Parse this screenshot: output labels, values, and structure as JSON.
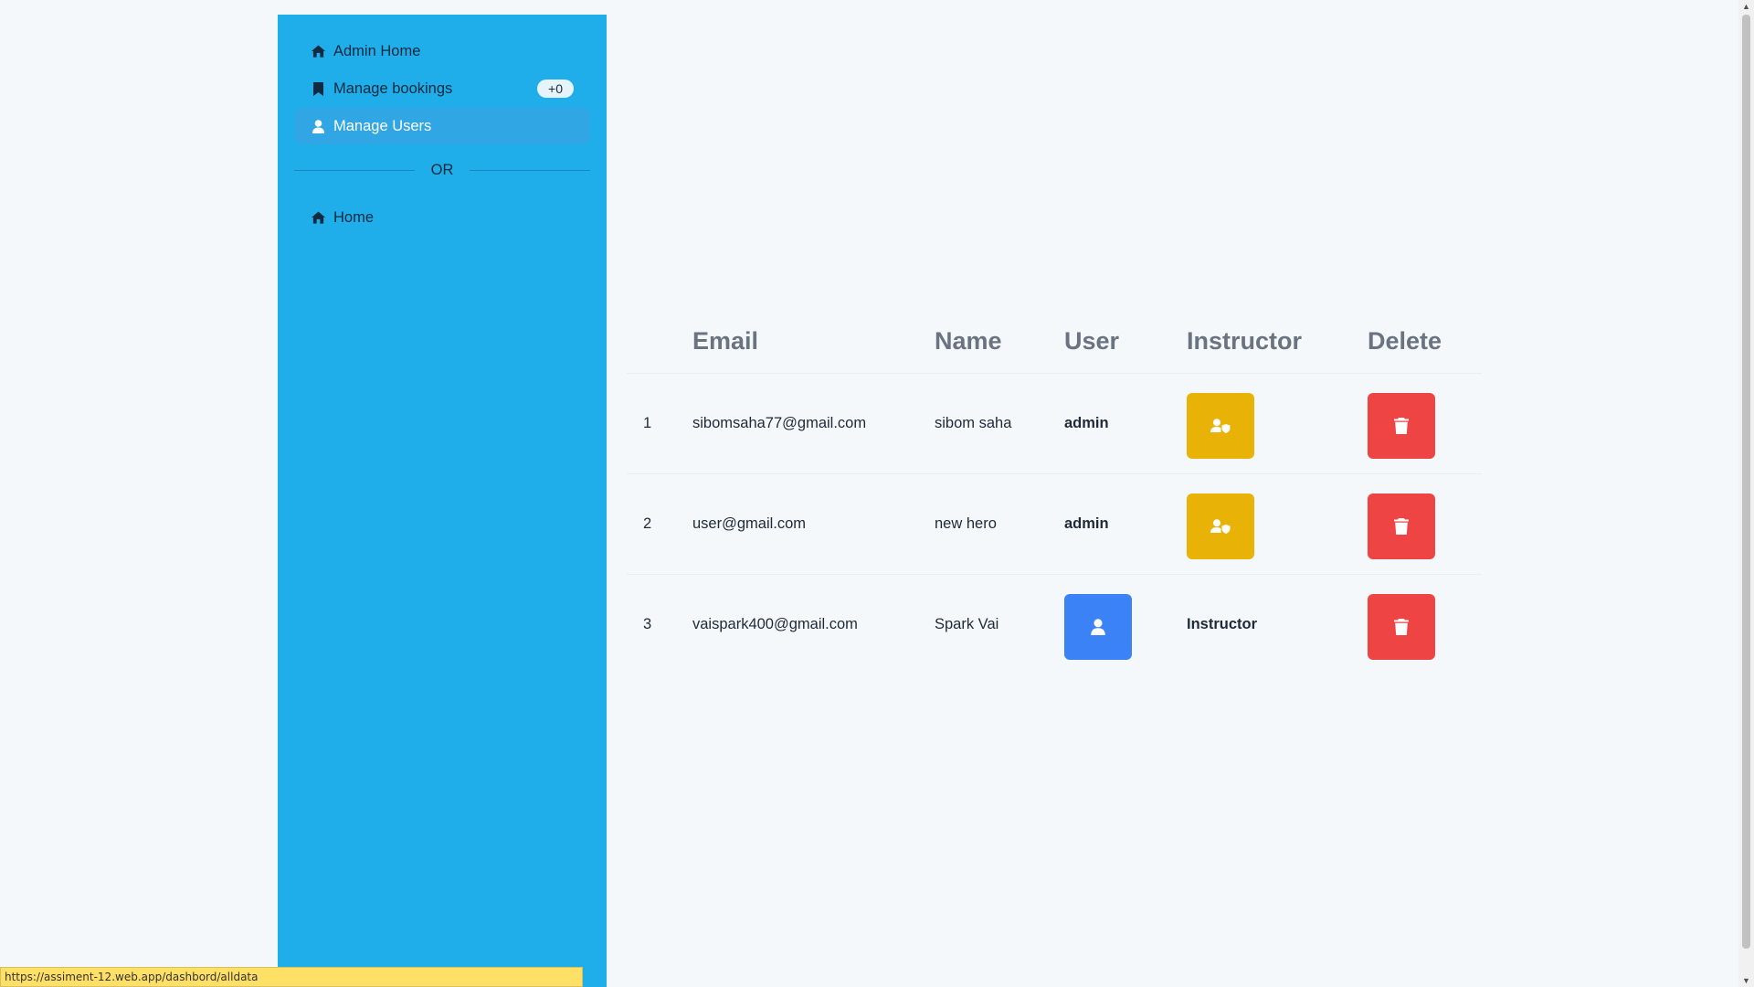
{
  "sidebar": {
    "items": [
      {
        "label": "Admin Home",
        "icon": "home-icon"
      },
      {
        "label": "Manage bookings",
        "icon": "bookmark-icon",
        "badge": "+0"
      },
      {
        "label": "Manage Users",
        "icon": "user-icon",
        "active": true
      }
    ],
    "divider": "OR",
    "bottom_items": [
      {
        "label": "Home",
        "icon": "home-icon"
      }
    ],
    "background": "#1faeea"
  },
  "table": {
    "headers": [
      "",
      "Email",
      "Name",
      "User",
      "Instructor",
      "Delete"
    ],
    "rows": [
      {
        "index": "1",
        "email": "sibomsaha77@gmail.com",
        "name": "sibom saha",
        "user": "admin",
        "instructor": "",
        "instructor_button": "make-instructor",
        "user_button": "",
        "delete_button": "delete"
      },
      {
        "index": "2",
        "email": "user@gmail.com",
        "name": "new hero",
        "user": "admin",
        "instructor": "",
        "instructor_button": "make-instructor",
        "user_button": "",
        "delete_button": "delete"
      },
      {
        "index": "3",
        "email": "vaispark400@gmail.com",
        "name": "Spark Vai",
        "user": "",
        "instructor": "Instructor",
        "instructor_button": "",
        "user_button": "make-admin",
        "delete_button": "delete"
      }
    ]
  },
  "colors": {
    "instructor_button": "#e8b306",
    "delete_button": "#ef4444",
    "user_button": "#3b82f6"
  },
  "statusbar": {
    "url": "https://assiment-12.web.app/dashbord/alldata"
  }
}
